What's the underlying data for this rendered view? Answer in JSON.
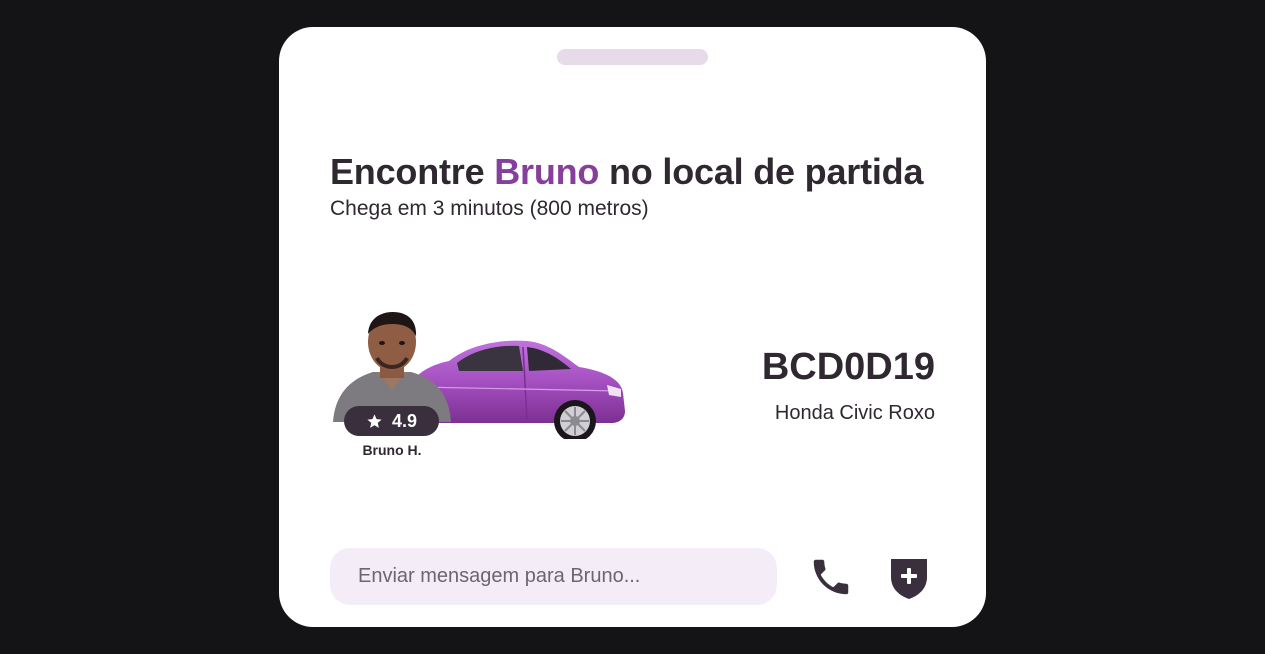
{
  "trip": {
    "title_prefix": "Encontre ",
    "driver_first_name": "Bruno",
    "title_suffix": " no local de partida",
    "eta": "Chega em 3 minutos (800 metros)"
  },
  "driver": {
    "rating": "4.9",
    "display_name": "Bruno H."
  },
  "vehicle": {
    "plate": "BCD0D19",
    "model": "Honda Civic Roxo",
    "color": "#a54fc1"
  },
  "message": {
    "placeholder": "Enviar mensagem para Bruno...",
    "value": ""
  },
  "actions": {
    "call_icon": "phone-icon",
    "safety_icon": "shield-plus-icon"
  },
  "colors": {
    "accent": "#86409b",
    "text": "#2f2831",
    "background": "#141315",
    "input_background": "#f4edf7",
    "rating_badge": "#3a2f3c"
  }
}
